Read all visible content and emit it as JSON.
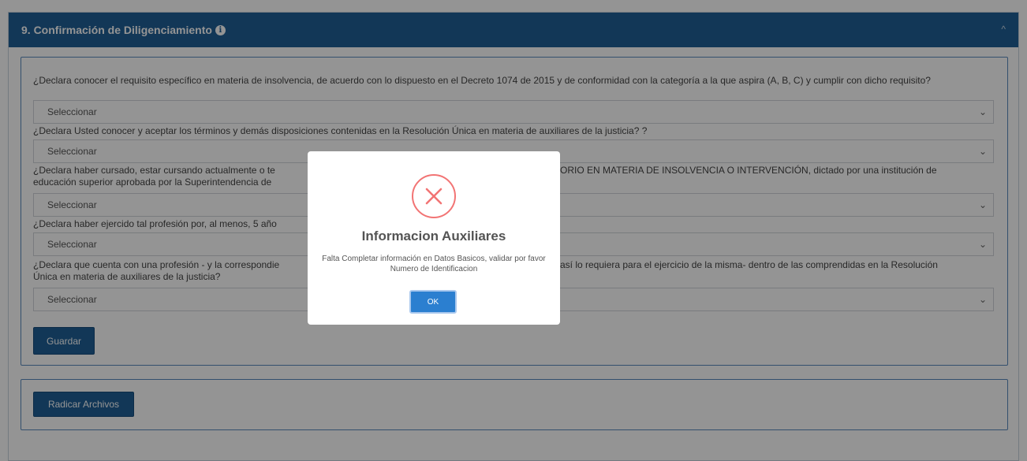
{
  "panel": {
    "title": "9. Confirmación de Diligenciamiento",
    "info_icon_glyph": "i",
    "collapse_glyph": "^"
  },
  "form": {
    "questions": [
      {
        "text": "¿Declara conocer el requisito específico en materia de insolvencia, de acuerdo con lo dispuesto en el Decreto 1074 de 2015 y de conformidad con la categoría a la que aspira (A, B, C) y cumplir con dicho requisito?",
        "select": "Seleccionar"
      },
      {
        "text": "¿Declara Usted conocer y aceptar los términos y demás disposiciones contenidas en la Resolución Única en materia de auxiliares de la justicia? ?",
        "select": "Seleccionar"
      },
      {
        "text": "¿Declara haber cursado, estar cursando actualmente o te... ORIO EN MATERIA DE INSOLVENCIA O INTERVENCIÓN, dictado por una institución de educación superior aprobada por la Superintendencia de...",
        "text_left": "¿Declara haber cursado, estar cursando actualmente o te",
        "text_right": "ORIO EN MATERIA DE INSOLVENCIA O INTERVENCIÓN, dictado por una institución de",
        "text_line2": "educación superior aprobada por la Superintendencia de",
        "select": "Seleccionar"
      },
      {
        "text": "¿Declara haber ejercido tal profesión por, al menos, 5 año",
        "select": "Seleccionar"
      },
      {
        "text_left": "¿Declara que cuenta con una profesión - y la correspondie",
        "text_right": "así lo requiera para el ejercicio de la misma- dentro de las comprendidas en la Resolución",
        "text_line2": "Única en materia de auxiliares de la justicia?",
        "select": "Seleccionar"
      }
    ],
    "chevron_glyph": "⌄",
    "save_label": "Guardar"
  },
  "upload": {
    "label": "Radicar Archivos"
  },
  "modal": {
    "title": "Informacion Auxiliares",
    "message": "Falta Completar información en Datos Basicos, validar por favor Numero de Identificacion",
    "ok_label": "OK",
    "error_color": "#f27474",
    "ok_color": "#2b7fd0"
  },
  "colors": {
    "header": "#1f5f96",
    "primary_button": "#1f5f96"
  }
}
